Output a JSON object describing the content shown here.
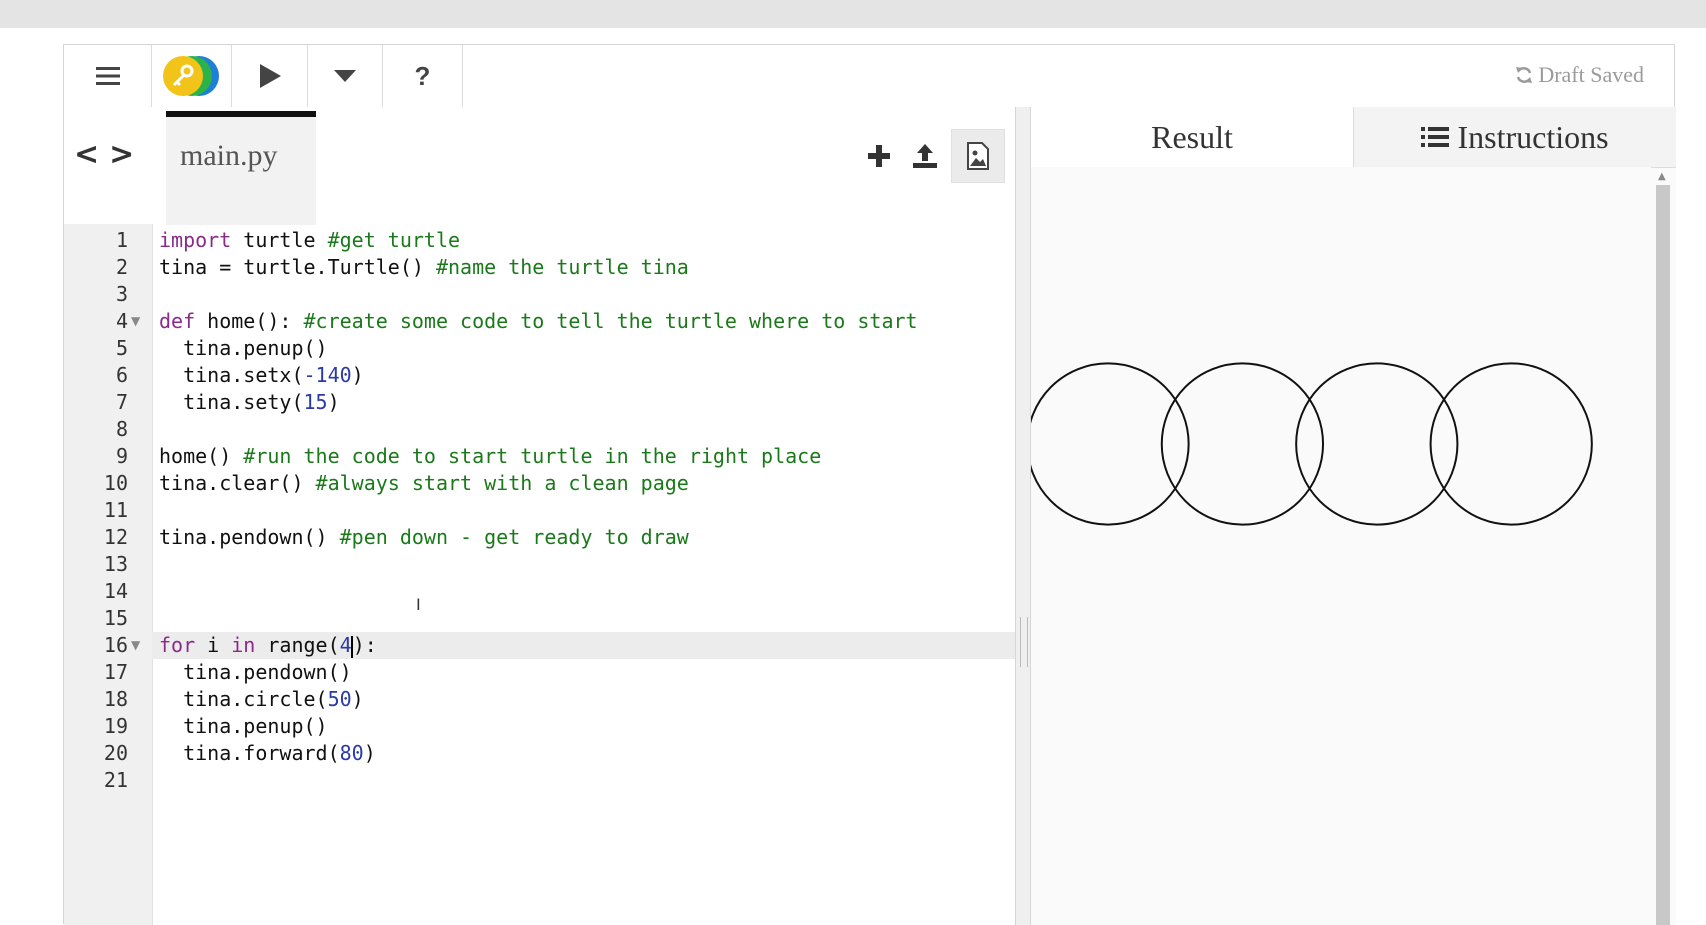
{
  "toolbar": {
    "menu_icon": "hamburger-menu-icon",
    "logo_icon": "key-logo-icon",
    "run_icon": "play-icon",
    "dropdown_icon": "caret-down-icon",
    "help_label": "?",
    "draft_status": "Draft Saved"
  },
  "editor": {
    "filename": "main.py",
    "nav_prev": "<",
    "nav_next": ">",
    "lines": [
      {
        "n": "1"
      },
      {
        "n": "2"
      },
      {
        "n": "3"
      },
      {
        "n": "4"
      },
      {
        "n": "5"
      },
      {
        "n": "6"
      },
      {
        "n": "7"
      },
      {
        "n": "8"
      },
      {
        "n": "9"
      },
      {
        "n": "10"
      },
      {
        "n": "11"
      },
      {
        "n": "12"
      },
      {
        "n": "13"
      },
      {
        "n": "14"
      },
      {
        "n": "15"
      },
      {
        "n": "16"
      },
      {
        "n": "17"
      },
      {
        "n": "18"
      },
      {
        "n": "19"
      },
      {
        "n": "20"
      },
      {
        "n": "21"
      }
    ],
    "code": {
      "l1_kw": "import",
      "l1_a": " turtle ",
      "l1_c": "#get turtle",
      "l2_a": "tina = turtle.Turtle() ",
      "l2_c": "#name the turtle tina",
      "l4_kw": "def",
      "l4_a": " home(): ",
      "l4_c": "#create some code to tell the turtle where to start",
      "l5_a": "  tina.penup()",
      "l6_a": "  tina.setx(",
      "l6_n": "-140",
      "l6_b": ")",
      "l7_a": "  tina.sety(",
      "l7_n": "15",
      "l7_b": ")",
      "l9_a": "home() ",
      "l9_c": "#run the code to start turtle in the right place",
      "l10_a": "tina.clear() ",
      "l10_c": "#always start with a clean page",
      "l12_a": "tina.pendown() ",
      "l12_c": "#pen down - get ready to draw",
      "l16_kw1": "for",
      "l16_a": " i ",
      "l16_kw2": "in",
      "l16_b": " range(",
      "l16_n": "4",
      "l16_c": "):",
      "l17_a": "  tina.pendown()",
      "l18_a": "  tina.circle(",
      "l18_n": "50",
      "l18_b": ")",
      "l19_a": "  tina.penup()",
      "l20_a": "  tina.forward(",
      "l20_n": "80",
      "l20_b": ")"
    },
    "active_line": "16"
  },
  "result_pane": {
    "result_tab": "Result",
    "instructions_tab": "Instructions",
    "drawing": {
      "shape": "circle",
      "count": 4,
      "radius": 50,
      "spacing": 80,
      "stroke_color": "#111111"
    }
  },
  "colors": {
    "keyword": "#8a2b8a",
    "comment": "#1a7a1a",
    "number": "#2a3aa8"
  }
}
